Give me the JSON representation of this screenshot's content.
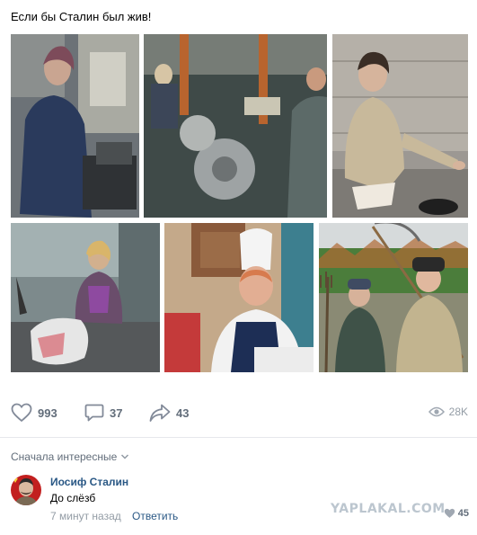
{
  "post": {
    "text": "Если бы Сталин был жив!"
  },
  "photos": [
    {
      "name": "photo-woman-at-lathe"
    },
    {
      "name": "photo-factory-workers"
    },
    {
      "name": "photo-man-crouching"
    },
    {
      "name": "photo-woman-sitting"
    },
    {
      "name": "photo-cook-in-hat"
    },
    {
      "name": "photo-farmers-with-tools"
    }
  ],
  "actions": {
    "likes": "993",
    "comments": "37",
    "shares": "43",
    "views": "28K"
  },
  "comments": {
    "sort_label": "Сначала интересные",
    "items": [
      {
        "author": "Иосиф Сталин",
        "text": "До слёзб",
        "time": "7 минут назад",
        "reply_label": "Ответить",
        "likes": "45"
      }
    ]
  },
  "watermark": "YAPLAKAL.COM",
  "colors": {
    "link": "#2a5885",
    "muted": "#939ca5",
    "icon": "#626d7a",
    "divider": "#e7e8ec"
  }
}
